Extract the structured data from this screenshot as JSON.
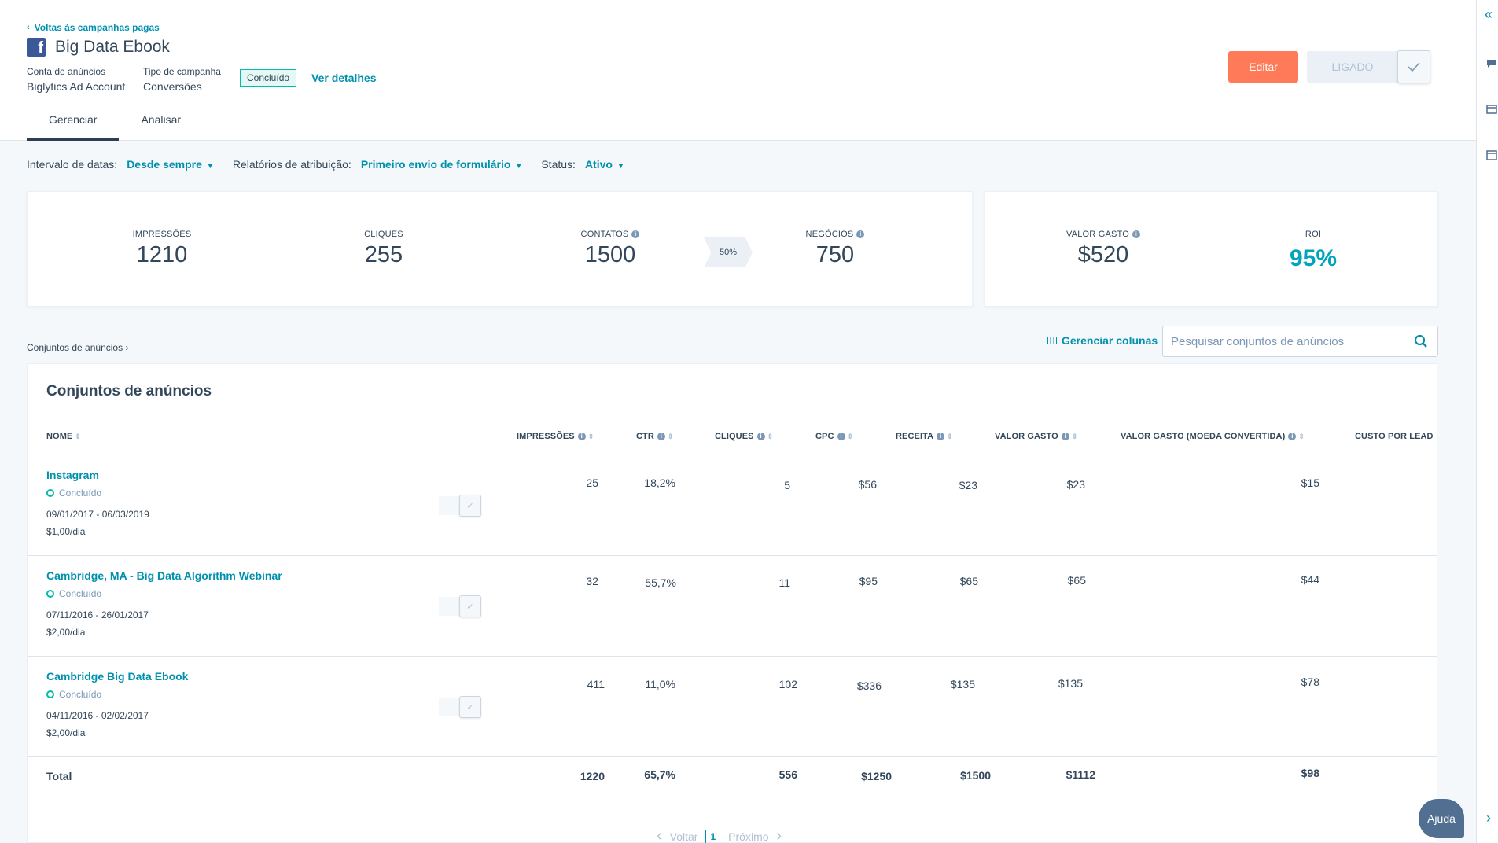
{
  "header": {
    "back_link": "Voltas às campanhas pagas",
    "title": "Big Data Ebook",
    "ad_account_label": "Conta de anúncios",
    "ad_account_value": "Biglytics Ad Account",
    "campaign_type_label": "Tipo de campanha",
    "campaign_type_value": "Conversões",
    "status_pill": "Concluído",
    "details_link": "Ver detalhes",
    "edit_button": "Editar",
    "on_button": "LIGADO"
  },
  "tabs": [
    {
      "label": "Gerenciar",
      "active": true
    },
    {
      "label": "Analisar",
      "active": false
    }
  ],
  "filters": {
    "date_label": "Intervalo de datas:",
    "date_value": "Desde sempre",
    "attribution_label": "Relatórios de atribuição:",
    "attribution_value": "Primeiro envio de formulário",
    "status_label": "Status:",
    "status_value": "Ativo"
  },
  "stats": {
    "impressions_label": "IMPRESSÕES",
    "impressions_value": "1210",
    "clicks_label": "CLIQUES",
    "clicks_value": "255",
    "contacts_label": "CONTATOS",
    "contacts_value": "1500",
    "conversion_rate": "50%",
    "deals_label": "NEGÓCIOS",
    "deals_value": "750",
    "spent_label": "VALOR GASTO",
    "spent_value": "$520",
    "roi_label": "ROI",
    "roi_value": "95%",
    "roi_color": "#00a4bd"
  },
  "breadcrumb": "Conjuntos de anúncios",
  "manage_columns": "Gerenciar colunas",
  "search": {
    "placeholder": "Pesquisar conjuntos de anúncios"
  },
  "table": {
    "title": "Conjuntos de anúncios",
    "columns": {
      "name": "NOME",
      "impressions": "IMPRESSÕES",
      "ctr": "CTR",
      "clicks": "CLIQUES",
      "cpc": "CPC",
      "revenue": "RECEITA",
      "spent": "VALOR GASTO",
      "spent_converted": "VALOR GASTO (MOEDA CONVERTIDA)",
      "cost_per_lead": "CUSTO POR LEAD"
    },
    "rows": [
      {
        "name": "Instagram",
        "status": "Concluído",
        "dates": "09/01/2017 - 06/03/2019",
        "budget": "$1,00/dia",
        "impressions": "25",
        "ctr": "18,2%",
        "clicks": "5",
        "cpc": "$56",
        "revenue": "$23",
        "spent": "$23",
        "spent_converted": "$15",
        "cost_per_lead": "$"
      },
      {
        "name": "Cambridge, MA - Big Data Algorithm Webinar",
        "status": "Concluído",
        "dates": "07/11/2016 - 26/01/2017",
        "budget": "$2,00/dia",
        "impressions": "32",
        "ctr": "55,7%",
        "clicks": "11",
        "cpc": "$95",
        "revenue": "$65",
        "spent": "$65",
        "spent_converted": "$44",
        "cost_per_lead": "$"
      },
      {
        "name": "Cambridge Big Data Ebook",
        "status": "Concluído",
        "dates": "04/11/2016 - 02/02/2017",
        "budget": "$2,00/dia",
        "impressions": "411",
        "ctr": "11,0%",
        "clicks": "102",
        "cpc": "$336",
        "revenue": "$135",
        "spent": "$135",
        "spent_converted": "$78",
        "cost_per_lead": "$"
      }
    ],
    "total": {
      "label": "Total",
      "impressions": "1220",
      "ctr": "65,7%",
      "clicks": "556",
      "cpc": "$1250",
      "revenue": "$1500",
      "spent": "$1112",
      "spent_converted": "$98",
      "cost_per_lead": "$"
    }
  },
  "pager": {
    "prev": "Voltar",
    "page": "1",
    "next": "Próximo"
  },
  "help_button": "Ajuda",
  "colors": {
    "accent": "#0091ae",
    "edit": "#ff7a59",
    "success": "#00bda5"
  }
}
